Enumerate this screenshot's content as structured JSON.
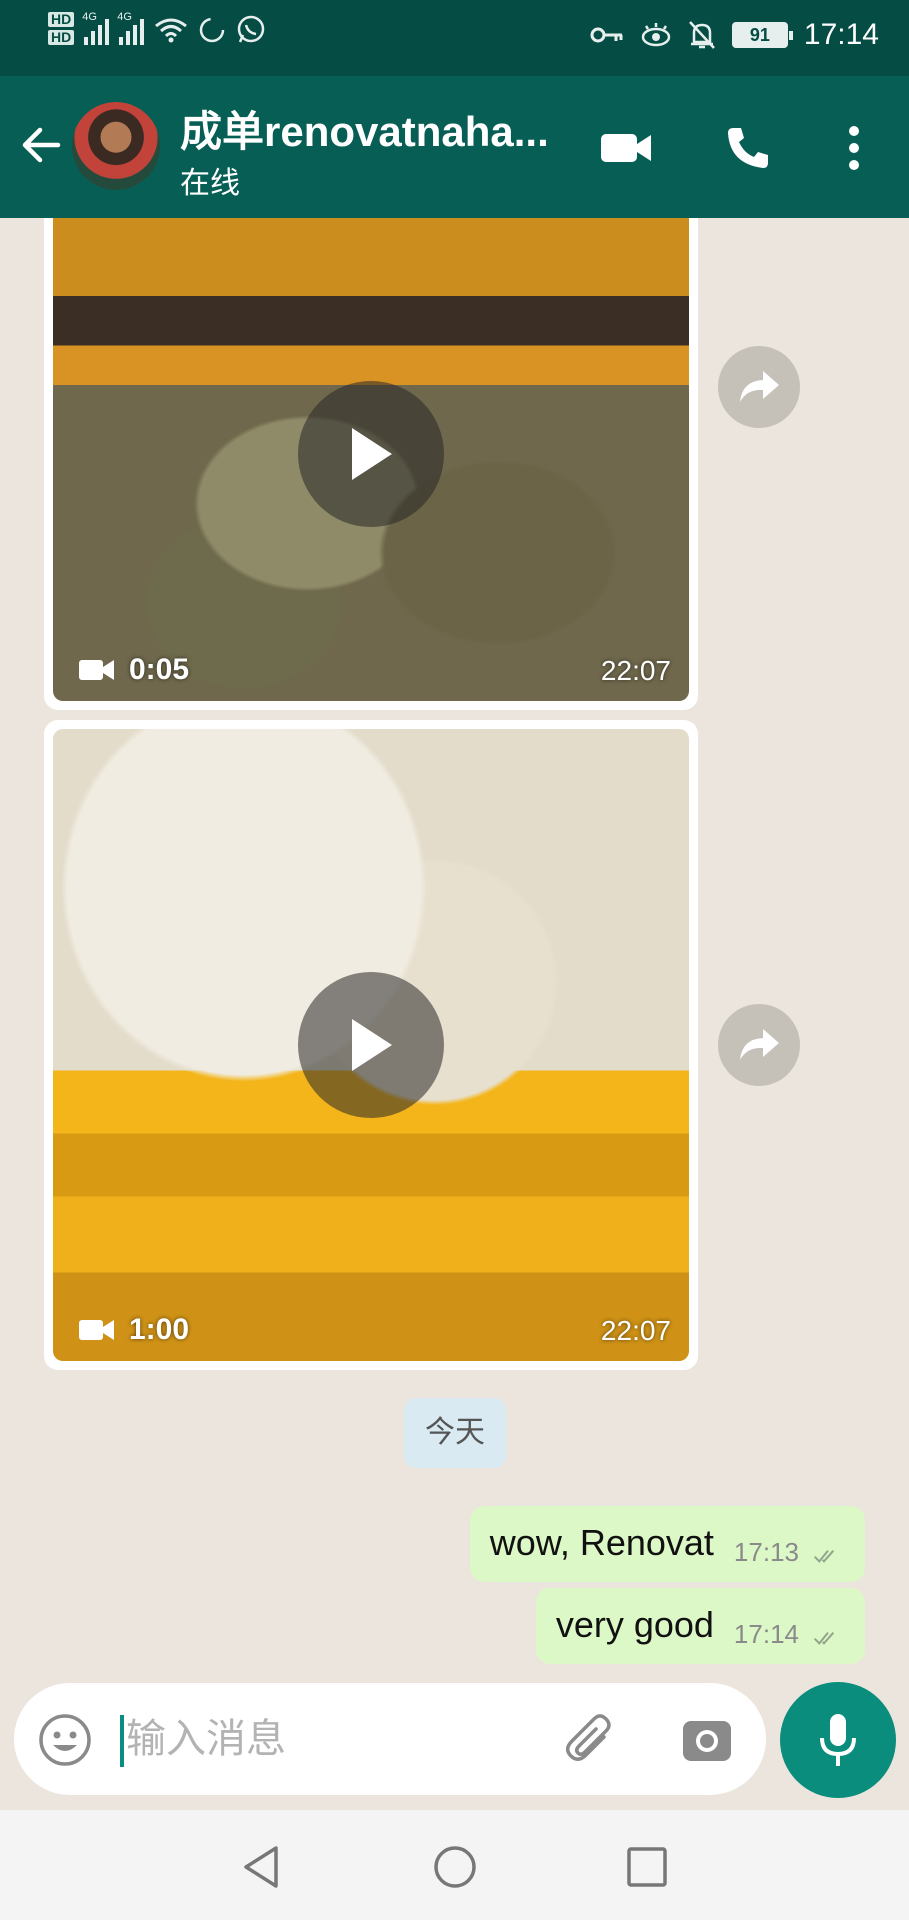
{
  "status_bar": {
    "network_1": "4G",
    "network_2": "4G",
    "battery": "91",
    "time": "17:14"
  },
  "header": {
    "contact_name": "成单renovatnaha...",
    "status": "在线"
  },
  "colors": {
    "header": "#075e54",
    "status_bar": "#054d44",
    "outgoing_bubble": "#dcf8c6",
    "accent": "#0a8d7c",
    "chat_bg": "#ece5dd"
  },
  "messages": {
    "video_1": {
      "duration": "0:05",
      "time": "22:07"
    },
    "video_2": {
      "duration": "1:00",
      "time": "22:07"
    },
    "date_divider": "今天",
    "outgoing": [
      {
        "text": "wow, Renovat",
        "time": "17:13"
      },
      {
        "text": "very good",
        "time": "17:14"
      }
    ]
  },
  "composer": {
    "placeholder": "输入消息"
  },
  "icons": [
    "back-arrow-icon",
    "video-call-icon",
    "phone-icon",
    "more-vert-icon",
    "forward-icon",
    "play-icon",
    "videocam-icon",
    "double-check-icon",
    "emoji-icon",
    "attach-icon",
    "camera-icon",
    "mic-icon",
    "nav-back-icon",
    "nav-home-icon",
    "nav-recents-icon"
  ]
}
